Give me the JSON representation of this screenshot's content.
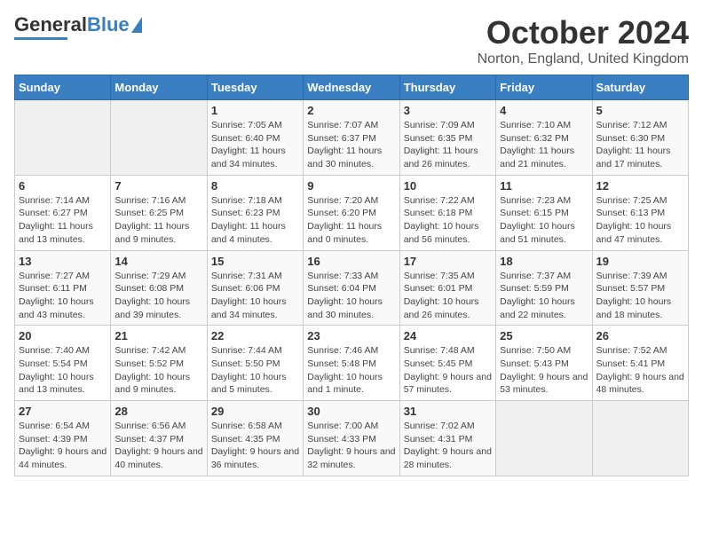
{
  "header": {
    "logo_general": "General",
    "logo_blue": "Blue",
    "title": "October 2024",
    "location": "Norton, England, United Kingdom"
  },
  "days_of_week": [
    "Sunday",
    "Monday",
    "Tuesday",
    "Wednesday",
    "Thursday",
    "Friday",
    "Saturday"
  ],
  "weeks": [
    [
      {
        "day": "",
        "info": ""
      },
      {
        "day": "",
        "info": ""
      },
      {
        "day": "1",
        "info": "Sunrise: 7:05 AM\nSunset: 6:40 PM\nDaylight: 11 hours and 34 minutes."
      },
      {
        "day": "2",
        "info": "Sunrise: 7:07 AM\nSunset: 6:37 PM\nDaylight: 11 hours and 30 minutes."
      },
      {
        "day": "3",
        "info": "Sunrise: 7:09 AM\nSunset: 6:35 PM\nDaylight: 11 hours and 26 minutes."
      },
      {
        "day": "4",
        "info": "Sunrise: 7:10 AM\nSunset: 6:32 PM\nDaylight: 11 hours and 21 minutes."
      },
      {
        "day": "5",
        "info": "Sunrise: 7:12 AM\nSunset: 6:30 PM\nDaylight: 11 hours and 17 minutes."
      }
    ],
    [
      {
        "day": "6",
        "info": "Sunrise: 7:14 AM\nSunset: 6:27 PM\nDaylight: 11 hours and 13 minutes."
      },
      {
        "day": "7",
        "info": "Sunrise: 7:16 AM\nSunset: 6:25 PM\nDaylight: 11 hours and 9 minutes."
      },
      {
        "day": "8",
        "info": "Sunrise: 7:18 AM\nSunset: 6:23 PM\nDaylight: 11 hours and 4 minutes."
      },
      {
        "day": "9",
        "info": "Sunrise: 7:20 AM\nSunset: 6:20 PM\nDaylight: 11 hours and 0 minutes."
      },
      {
        "day": "10",
        "info": "Sunrise: 7:22 AM\nSunset: 6:18 PM\nDaylight: 10 hours and 56 minutes."
      },
      {
        "day": "11",
        "info": "Sunrise: 7:23 AM\nSunset: 6:15 PM\nDaylight: 10 hours and 51 minutes."
      },
      {
        "day": "12",
        "info": "Sunrise: 7:25 AM\nSunset: 6:13 PM\nDaylight: 10 hours and 47 minutes."
      }
    ],
    [
      {
        "day": "13",
        "info": "Sunrise: 7:27 AM\nSunset: 6:11 PM\nDaylight: 10 hours and 43 minutes."
      },
      {
        "day": "14",
        "info": "Sunrise: 7:29 AM\nSunset: 6:08 PM\nDaylight: 10 hours and 39 minutes."
      },
      {
        "day": "15",
        "info": "Sunrise: 7:31 AM\nSunset: 6:06 PM\nDaylight: 10 hours and 34 minutes."
      },
      {
        "day": "16",
        "info": "Sunrise: 7:33 AM\nSunset: 6:04 PM\nDaylight: 10 hours and 30 minutes."
      },
      {
        "day": "17",
        "info": "Sunrise: 7:35 AM\nSunset: 6:01 PM\nDaylight: 10 hours and 26 minutes."
      },
      {
        "day": "18",
        "info": "Sunrise: 7:37 AM\nSunset: 5:59 PM\nDaylight: 10 hours and 22 minutes."
      },
      {
        "day": "19",
        "info": "Sunrise: 7:39 AM\nSunset: 5:57 PM\nDaylight: 10 hours and 18 minutes."
      }
    ],
    [
      {
        "day": "20",
        "info": "Sunrise: 7:40 AM\nSunset: 5:54 PM\nDaylight: 10 hours and 13 minutes."
      },
      {
        "day": "21",
        "info": "Sunrise: 7:42 AM\nSunset: 5:52 PM\nDaylight: 10 hours and 9 minutes."
      },
      {
        "day": "22",
        "info": "Sunrise: 7:44 AM\nSunset: 5:50 PM\nDaylight: 10 hours and 5 minutes."
      },
      {
        "day": "23",
        "info": "Sunrise: 7:46 AM\nSunset: 5:48 PM\nDaylight: 10 hours and 1 minute."
      },
      {
        "day": "24",
        "info": "Sunrise: 7:48 AM\nSunset: 5:45 PM\nDaylight: 9 hours and 57 minutes."
      },
      {
        "day": "25",
        "info": "Sunrise: 7:50 AM\nSunset: 5:43 PM\nDaylight: 9 hours and 53 minutes."
      },
      {
        "day": "26",
        "info": "Sunrise: 7:52 AM\nSunset: 5:41 PM\nDaylight: 9 hours and 48 minutes."
      }
    ],
    [
      {
        "day": "27",
        "info": "Sunrise: 6:54 AM\nSunset: 4:39 PM\nDaylight: 9 hours and 44 minutes."
      },
      {
        "day": "28",
        "info": "Sunrise: 6:56 AM\nSunset: 4:37 PM\nDaylight: 9 hours and 40 minutes."
      },
      {
        "day": "29",
        "info": "Sunrise: 6:58 AM\nSunset: 4:35 PM\nDaylight: 9 hours and 36 minutes."
      },
      {
        "day": "30",
        "info": "Sunrise: 7:00 AM\nSunset: 4:33 PM\nDaylight: 9 hours and 32 minutes."
      },
      {
        "day": "31",
        "info": "Sunrise: 7:02 AM\nSunset: 4:31 PM\nDaylight: 9 hours and 28 minutes."
      },
      {
        "day": "",
        "info": ""
      },
      {
        "day": "",
        "info": ""
      }
    ]
  ]
}
